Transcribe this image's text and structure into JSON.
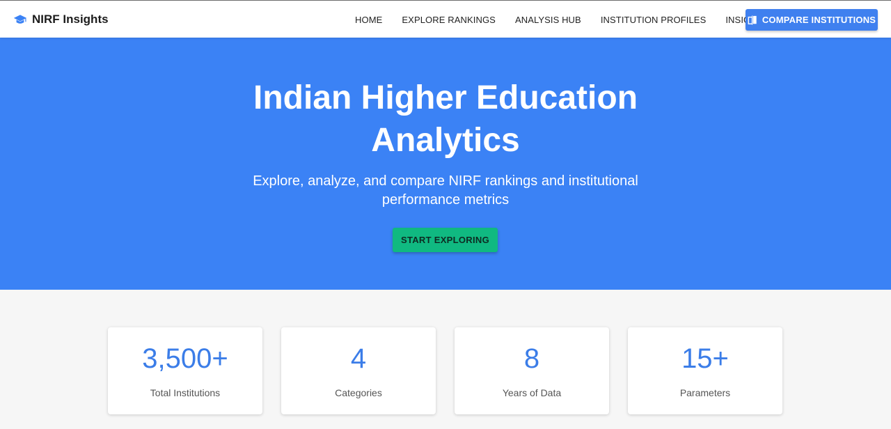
{
  "navbar": {
    "brand": "NIRF Insights",
    "brand_icon": "graduation-cap-icon",
    "links": [
      "HOME",
      "EXPLORE RANKINGS",
      "ANALYSIS HUB",
      "INSTITUTION PROFILES",
      "INSIGHTS"
    ],
    "compare_button": {
      "label": "COMPARE INSTITUTIONS",
      "icon": "compare-icon"
    }
  },
  "hero": {
    "title": "Indian Higher Education Analytics",
    "subtitle": "Explore, analyze, and compare NIRF rankings and institutional performance metrics",
    "cta": "START EXPLORING"
  },
  "stats": [
    {
      "value": "3,500+",
      "label": "Total Institutions"
    },
    {
      "value": "4",
      "label": "Categories"
    },
    {
      "value": "8",
      "label": "Years of Data"
    },
    {
      "value": "15+",
      "label": "Parameters"
    }
  ],
  "colors": {
    "primary": "#3b82f5",
    "accent": "#10b981",
    "stat_value": "#3b7de8"
  }
}
